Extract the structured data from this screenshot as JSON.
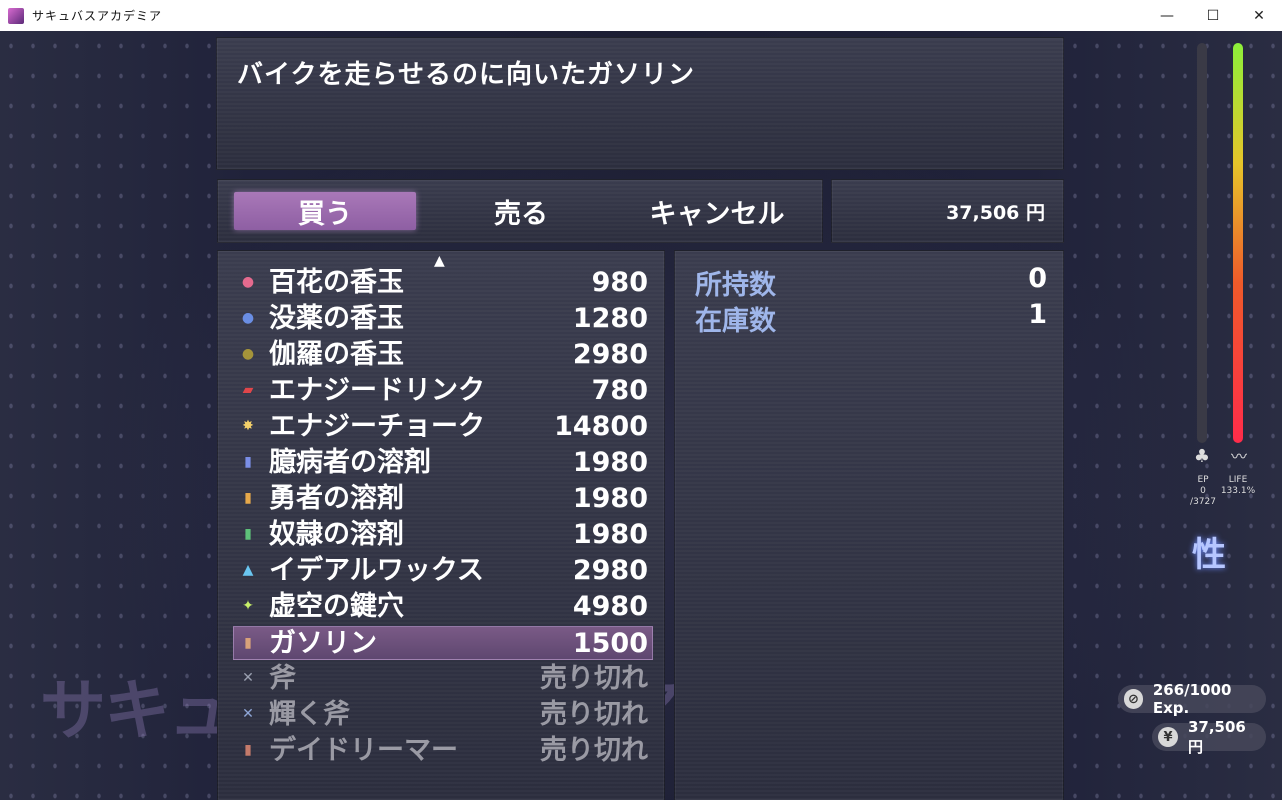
{
  "window": {
    "title": "サキュバスアカデミア",
    "minimize": "—",
    "maximize": "☐",
    "close": "✕"
  },
  "help": {
    "text": "バイクを走らせるのに向いたガソリン"
  },
  "commands": {
    "buy": "買う",
    "sell": "売る",
    "cancel": "キャンセル"
  },
  "gold": {
    "amount": "37,506 円"
  },
  "list": {
    "scroll_up_glyph": "▲",
    "items": [
      {
        "name": "百花の香玉",
        "price": "980",
        "icon": "pink-orb-icon",
        "color": "#e46a8e",
        "glyph": "●"
      },
      {
        "name": "没薬の香玉",
        "price": "1280",
        "icon": "blue-orb-icon",
        "color": "#6a8ee4",
        "glyph": "●"
      },
      {
        "name": "伽羅の香玉",
        "price": "2980",
        "icon": "olive-orb-icon",
        "color": "#a5943a",
        "glyph": "●"
      },
      {
        "name": "エナジードリンク",
        "price": "780",
        "icon": "can-icon",
        "color": "#e0464a",
        "glyph": "▰"
      },
      {
        "name": "エナジーチョーク",
        "price": "14800",
        "icon": "burst-icon",
        "color": "#f2cf6a",
        "glyph": "✸"
      },
      {
        "name": "臆病者の溶剤",
        "price": "1980",
        "icon": "blue-bottle-icon",
        "color": "#7a8ee6",
        "glyph": "▮"
      },
      {
        "name": "勇者の溶剤",
        "price": "1980",
        "icon": "yellow-bottle-icon",
        "color": "#e6a84a",
        "glyph": "▮"
      },
      {
        "name": "奴隷の溶剤",
        "price": "1980",
        "icon": "green-bottle-icon",
        "color": "#5ec27a",
        "glyph": "▮"
      },
      {
        "name": "イデアルワックス",
        "price": "2980",
        "icon": "flask-icon",
        "color": "#6ac6f0",
        "glyph": "▲"
      },
      {
        "name": "虚空の鍵穴",
        "price": "4980",
        "icon": "key-icon",
        "color": "#c8f06a",
        "glyph": "✦"
      },
      {
        "name": "ガソリン",
        "price": "1500",
        "icon": "fuel-bottle-icon",
        "color": "#d9a27a",
        "glyph": "▮"
      },
      {
        "name": "斧",
        "price": "売り切れ",
        "icon": "axe-icon",
        "color": "#9aa0b0",
        "glyph": "✕"
      },
      {
        "name": "輝く斧",
        "price": "売り切れ",
        "icon": "shining-axe-icon",
        "color": "#8fa6d6",
        "glyph": "✕"
      },
      {
        "name": "デイドリーマー",
        "price": "売り切れ",
        "icon": "potion-icon",
        "color": "#c47a6a",
        "glyph": "▮"
      }
    ]
  },
  "status": {
    "owned_label": "所持数",
    "owned_value": "0",
    "stock_label": "在庫数",
    "stock_value": "1"
  },
  "hud": {
    "ep_label": "EP",
    "ep_value": "0",
    "ep_max": "/3727",
    "life_label": "LIFE",
    "life_value": "133.1%",
    "ep_level": 0,
    "kanji": "性",
    "exp": "266/1000 Exp.",
    "money": "37,506 円",
    "money_icon": "¥",
    "compass_icon": "⊘"
  },
  "logo": {
    "text": "サキュバスアカデミア"
  }
}
